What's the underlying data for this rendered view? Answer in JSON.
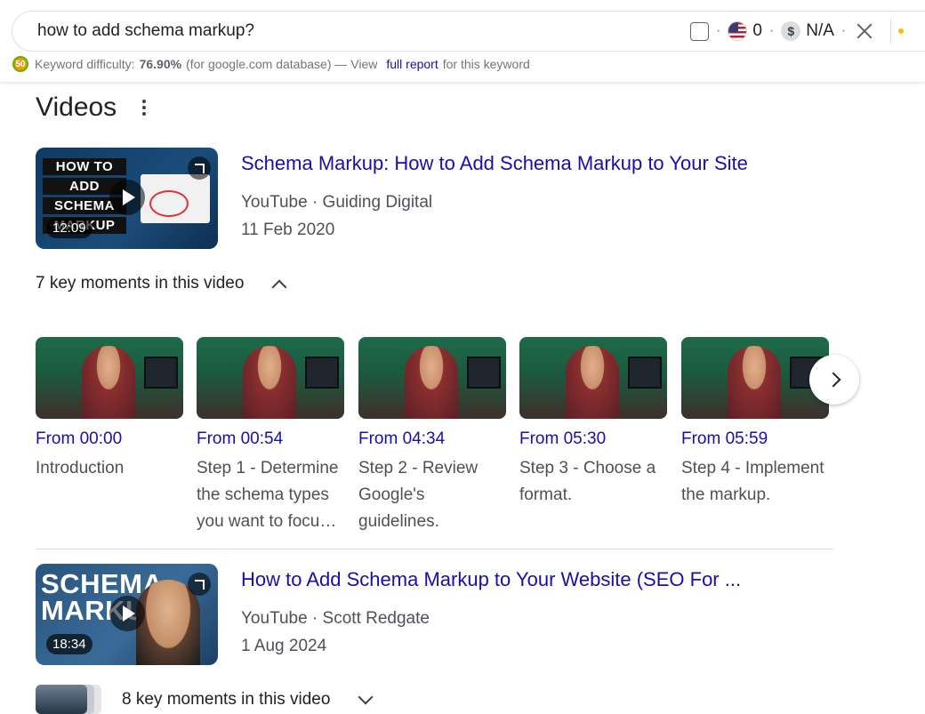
{
  "search": {
    "query": "how to add schema markup?",
    "volume_value": "0",
    "cpc_value": "N/A",
    "dot": "·"
  },
  "keyword_bar": {
    "prefix": "Keyword difficulty:",
    "difficulty": "76.90%",
    "db_text": "(for google.com database) — View",
    "link_text": "full report",
    "suffix": "for this keyword"
  },
  "videos": {
    "section_title": "Videos",
    "items": [
      {
        "title": "Schema Markup: How to Add Schema Markup to Your Site",
        "source": "YouTube · Guiding Digital",
        "date": "11 Feb 2020",
        "duration": "12:09",
        "thumb_lines": [
          "HOW TO",
          "ADD",
          "SCHEMA",
          "MARKUP"
        ],
        "key_moments_label": "7 key moments in this video",
        "key_moments_expanded": true,
        "moments": [
          {
            "from": "From 00:00",
            "label": "Introduction"
          },
          {
            "from": "From 00:54",
            "label": "Step 1 - Determine the schema types you want to focu…"
          },
          {
            "from": "From 04:34",
            "label": "Step 2 - Review Google's guidelines."
          },
          {
            "from": "From 05:30",
            "label": "Step 3 - Choose a format."
          },
          {
            "from": "From 05:59",
            "label": "Step 4 - Implement the markup."
          }
        ]
      },
      {
        "title": "How to Add Schema Markup to Your Website (SEO For ...",
        "source": "YouTube · Scott Redgate",
        "date": "1 Aug 2024",
        "duration": "18:34",
        "thumb_lines": [
          "SCHEMA",
          "MARKUP"
        ],
        "key_moments_label": "8 key moments in this video",
        "key_moments_expanded": false
      }
    ]
  },
  "colors": {
    "link": "#1a0dab",
    "meta_text": "#4d5156",
    "accent_logo": "#f29900"
  }
}
